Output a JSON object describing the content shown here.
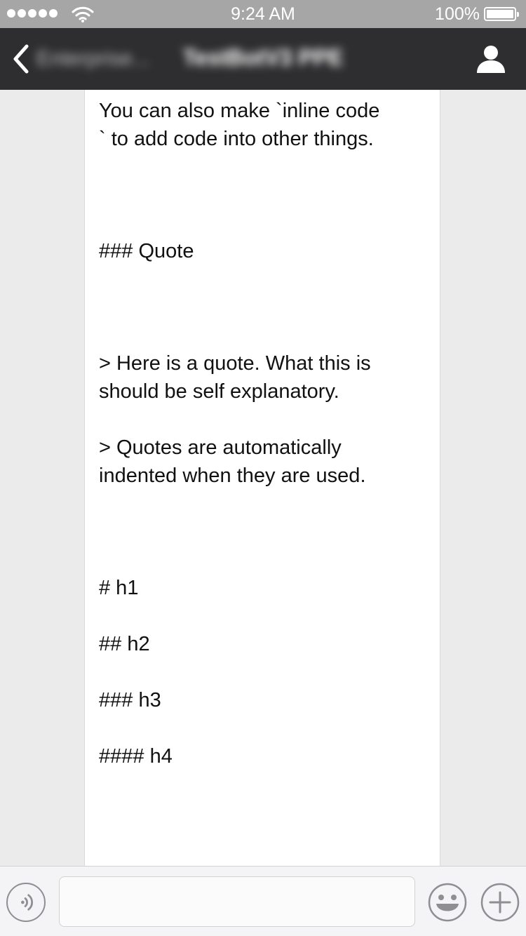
{
  "status_bar": {
    "signal_bars": 5,
    "time": "9:24 AM",
    "battery_percent": "100%"
  },
  "nav": {
    "back_label": "Enterprise...",
    "title": "TestBotV3 PPE",
    "back_icon": "chevron-left-icon",
    "profile_icon": "person-icon"
  },
  "message": {
    "lines": [
      "You can also make `inline code",
      "` to add code into other things.",
      "",
      "",
      "",
      "### Quote",
      "",
      "",
      "",
      "> Here is a quote. What this is",
      "should be self explanatory.",
      "",
      "> Quotes are automatically",
      "indented when they are used.",
      "",
      "",
      "",
      "# h1",
      "",
      "## h2",
      "",
      "### h3",
      "",
      "#### h4"
    ]
  },
  "input_bar": {
    "voice_icon": "voice-icon",
    "text_value": "",
    "emoji_icon": "emoji-icon",
    "plus_icon": "plus-icon"
  },
  "colors": {
    "status_bar_bg": "#a6a6a6",
    "nav_bg": "#2e2e30",
    "chat_bg": "#ebebeb",
    "card_bg": "#ffffff",
    "icon_gray": "#8e8e93"
  }
}
